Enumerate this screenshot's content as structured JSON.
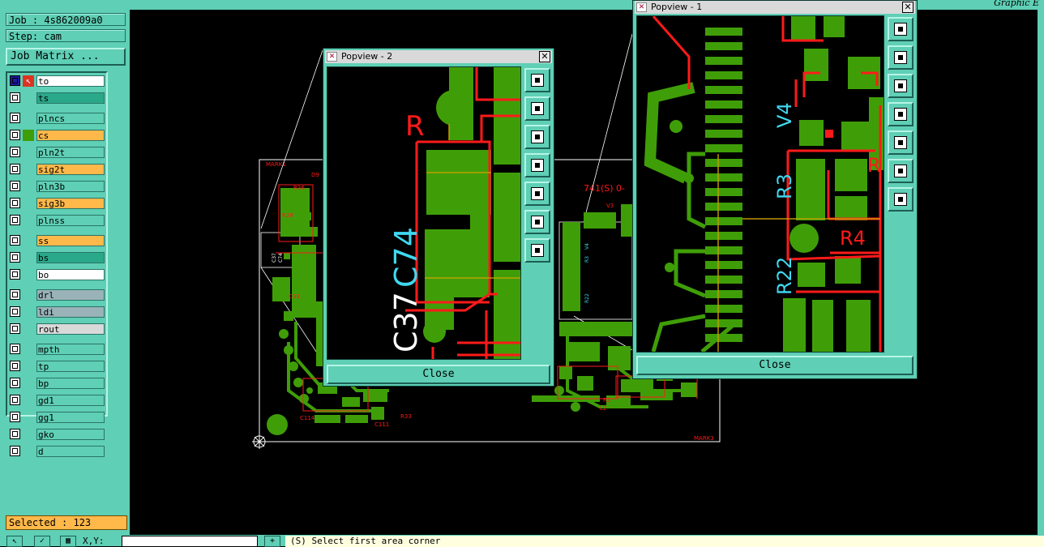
{
  "app": {
    "title": "Graphic E"
  },
  "job": {
    "label": "Job : 4s862009a0",
    "step": "Step: cam",
    "matrix_button": "Job Matrix ..."
  },
  "layers": [
    {
      "name": "to",
      "color": "#ffffff"
    },
    {
      "name": "ts",
      "color": "#2aa88a"
    },
    {
      "name": "plncs",
      "color": "#5fcfb5"
    },
    {
      "name": "cs",
      "color": "#ffb84a"
    },
    {
      "name": "pln2t",
      "color": "#5fcfb5"
    },
    {
      "name": "sig2t",
      "color": "#ffb84a"
    },
    {
      "name": "pln3b",
      "color": "#5fcfb5"
    },
    {
      "name": "sig3b",
      "color": "#ffb84a"
    },
    {
      "name": "plnss",
      "color": "#5fcfb5"
    },
    {
      "name": "ss",
      "color": "#ffb84a"
    },
    {
      "name": "bs",
      "color": "#2aa88a"
    },
    {
      "name": "bo",
      "color": "#ffffff"
    },
    {
      "name": "drl",
      "color": "#9ab3b8"
    },
    {
      "name": "ldi",
      "color": "#9ab3b8"
    },
    {
      "name": "rout",
      "color": "#d9d9d9"
    },
    {
      "name": "mpth",
      "color": "#5fcfb5"
    },
    {
      "name": "tp",
      "color": "#5fcfb5"
    },
    {
      "name": "bp",
      "color": "#5fcfb5"
    },
    {
      "name": "gd1",
      "color": "#5fcfb5"
    },
    {
      "name": "gg1",
      "color": "#5fcfb5"
    },
    {
      "name": "gko",
      "color": "#5fcfb5"
    },
    {
      "name": "d",
      "color": "#5fcfb5"
    }
  ],
  "status": {
    "selected": "Selected : 123"
  },
  "bottom": {
    "xy_label": "X,Y:",
    "prompt": "(S)   Select first area corner"
  },
  "board": {
    "mark1": "MARK1",
    "mark3": "MARK3",
    "label741": "741(S)  0-",
    "refs": [
      "D9",
      "R36",
      "R28",
      "C37",
      "C74",
      "R3",
      "V4",
      "V3",
      "R22",
      "C33",
      "R33",
      "C114",
      "C111",
      "R1",
      "L2"
    ]
  },
  "popview2": {
    "title": "Popview - 2",
    "close": "Close",
    "labels": {
      "c37": "C37",
      "c74": "C74",
      "r": "R"
    }
  },
  "popview1": {
    "title": "Popview - 1",
    "close": "Close",
    "labels": {
      "v4": "V4",
      "r3": "R3",
      "r22": "R22",
      "r4": "R4",
      "r": "R"
    }
  },
  "colors": {
    "panel": "#5fcfb5",
    "copper": "#3f9e08",
    "trace": "#ff1a1a",
    "silk": "#3fd8f0",
    "selected": "#ffb84a"
  }
}
